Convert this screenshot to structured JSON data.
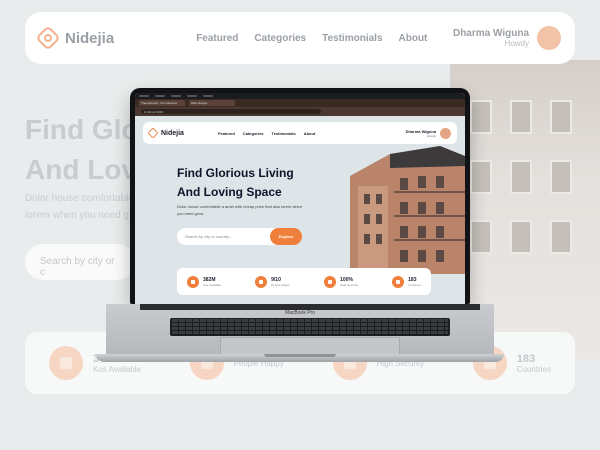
{
  "background": {
    "brand": "Nidejia",
    "menu": [
      "Featured",
      "Categories",
      "Testimonials",
      "About"
    ],
    "user_name": "Dharma Wiguna",
    "user_sub": "Howdy",
    "hero_title": [
      "Find Glo",
      "And Lov"
    ],
    "hero_desc": [
      "Dolor house comfortable",
      "lorem when you need g"
    ],
    "search_placeholder": "Search by city or c",
    "stats": [
      {
        "value": "3",
        "label": "Kos Available"
      },
      {
        "value": "",
        "label": "People Happy"
      },
      {
        "value": "",
        "label": "High Security"
      },
      {
        "value": "183",
        "label": "Countries"
      }
    ]
  },
  "browser": {
    "tabs": [
      "Themeforest - Item Review",
      "Web Design"
    ],
    "url": "localhost:3000"
  },
  "site": {
    "brand": "Nidejia",
    "menu": [
      "Featured",
      "Categories",
      "Testimonials",
      "About"
    ],
    "user_name": "Dharma Wiguna",
    "user_sub": "Howdy",
    "hero_title_line1": "Find Glorious Living",
    "hero_title_line2": "And Loving Space",
    "hero_desc": "Dolor house comfortable a amet with cheap price that also lorem when you need grow.",
    "search_placeholder": "Search by city or country...",
    "explore_label": "Explore",
    "stats": [
      {
        "value": "382M",
        "label": "Kos Available"
      },
      {
        "value": "9/10",
        "label": "People Happy"
      },
      {
        "value": "100%",
        "label": "High Security"
      },
      {
        "value": "183",
        "label": "Countries"
      }
    ]
  },
  "device": {
    "label": "MacBook Pro"
  },
  "colors": {
    "accent": "#f07f3c",
    "dark": "#12122a"
  }
}
